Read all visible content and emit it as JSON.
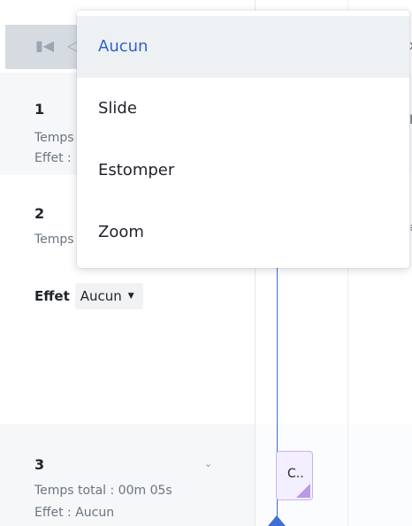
{
  "player": {
    "first_icon": "skip-to-start-icon",
    "prev_icon": "previous-icon"
  },
  "slides": [
    {
      "number": "1",
      "duration_text": "Temps",
      "effect_text": "Effet :"
    },
    {
      "number": "2",
      "duration_text": "Temps",
      "effect_label": "Effet",
      "effect_value": "Aucun"
    },
    {
      "number": "3",
      "duration_text": "Temps total : 00m 05s",
      "effect_text": "Effet : Aucun"
    }
  ],
  "timeline": {
    "clip_label": "C..",
    "edge_marks": [
      "x",
      "I",
      "≡"
    ]
  },
  "menu": {
    "items": [
      {
        "label": "Aucun",
        "selected": true
      },
      {
        "label": "Slide",
        "selected": false
      },
      {
        "label": "Estomper",
        "selected": false
      },
      {
        "label": "Zoom",
        "selected": false
      }
    ]
  },
  "colors": {
    "accent": "#2f62c9",
    "playhead": "#3d6fd6",
    "clip_border": "#c7b3ee",
    "clip_fill": "#f4efff"
  }
}
